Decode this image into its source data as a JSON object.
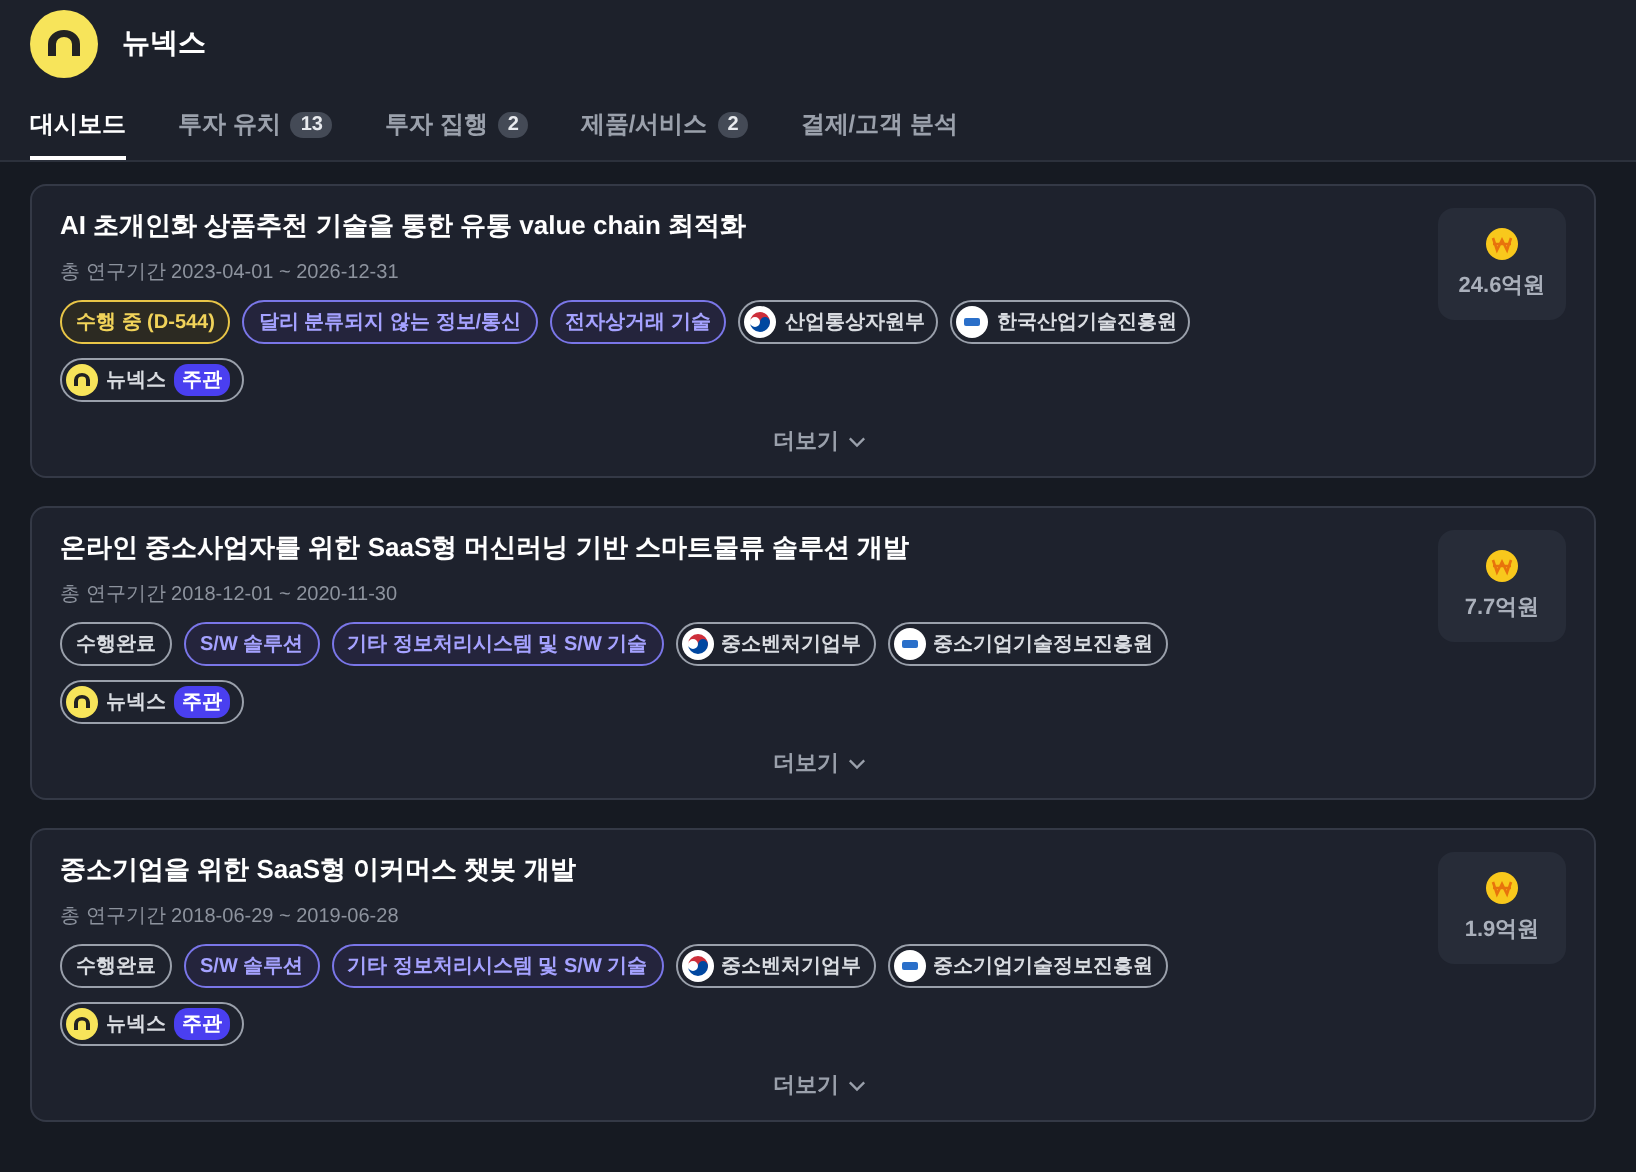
{
  "company": {
    "name": "뉴넥스"
  },
  "tabs": [
    {
      "label": "대시보드",
      "selected": true
    },
    {
      "label": "투자 유치",
      "count": "13",
      "selected": false
    },
    {
      "label": "투자 집행",
      "count": "2",
      "selected": false
    },
    {
      "label": "제품/서비스",
      "count": "2",
      "selected": false
    },
    {
      "label": "결제/고객 분석",
      "selected": false
    }
  ],
  "projects": [
    {
      "title": "AI 초개인화 상품추천 기술을 통한 유통 value chain 최적화",
      "period": "총 연구기간 2023-04-01 ~ 2026-12-31",
      "amount": "24.6억원",
      "tags": [
        {
          "kind": "status",
          "label": "수행 중 (D-544)",
          "active": true
        },
        {
          "kind": "category",
          "label": "달리 분류되지 않는 정보/통신"
        },
        {
          "kind": "category",
          "label": "전자상거래 기술"
        },
        {
          "kind": "ministry",
          "label": "산업통상자원부"
        },
        {
          "kind": "agency",
          "label": "한국산업기술진흥원"
        }
      ],
      "lead": {
        "name": "뉴넥스",
        "role": "주관"
      },
      "more": "더보기"
    },
    {
      "title": "온라인 중소사업자를 위한 SaaS형 머신러닝 기반 스마트물류 솔루션 개발",
      "period": "총 연구기간 2018-12-01 ~ 2020-11-30",
      "amount": "7.7억원",
      "tags": [
        {
          "kind": "status",
          "label": "수행완료",
          "active": false
        },
        {
          "kind": "category",
          "label": "S/W 솔루션"
        },
        {
          "kind": "category",
          "label": "기타 정보처리시스템 및 S/W 기술"
        },
        {
          "kind": "ministry",
          "label": "중소벤처기업부"
        },
        {
          "kind": "agency",
          "label": "중소기업기술정보진흥원"
        }
      ],
      "lead": {
        "name": "뉴넥스",
        "role": "주관"
      },
      "more": "더보기"
    },
    {
      "title": "중소기업을 위한 SaaS형 이커머스 챗봇 개발",
      "period": "총 연구기간 2018-06-29 ~ 2019-06-28",
      "amount": "1.9억원",
      "tags": [
        {
          "kind": "status",
          "label": "수행완료",
          "active": false
        },
        {
          "kind": "category",
          "label": "S/W 솔루션"
        },
        {
          "kind": "category",
          "label": "기타 정보처리시스템 및 S/W 기술"
        },
        {
          "kind": "ministry",
          "label": "중소벤처기업부"
        },
        {
          "kind": "agency",
          "label": "중소기업기술정보진흥원"
        }
      ],
      "lead": {
        "name": "뉴넥스",
        "role": "주관"
      },
      "more": "더보기"
    }
  ]
}
